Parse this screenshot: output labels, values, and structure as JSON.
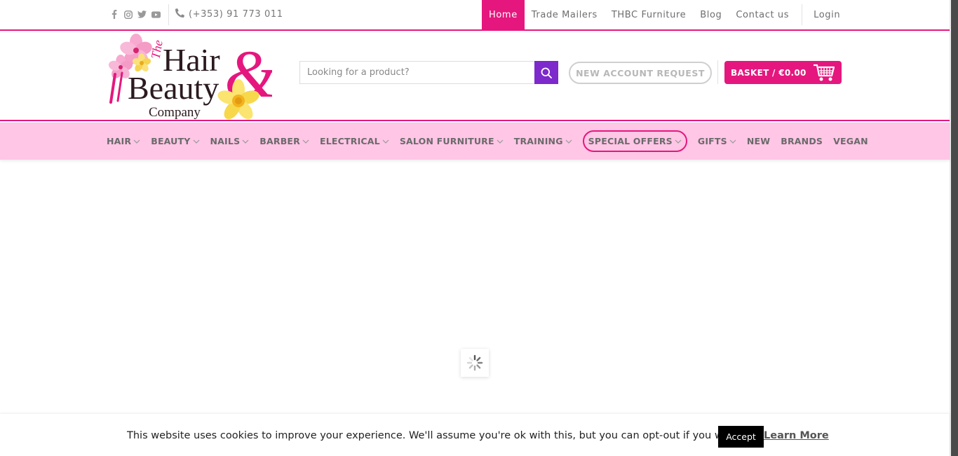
{
  "topbar": {
    "phone": "(+353) 91 773 011",
    "nav": [
      {
        "label": "Home",
        "active": true
      },
      {
        "label": "Trade Mailers",
        "active": false
      },
      {
        "label": "THBC Furniture",
        "active": false
      },
      {
        "label": "Blog",
        "active": false
      },
      {
        "label": "Contact us",
        "active": false
      }
    ],
    "login": "Login",
    "social_icons": [
      "facebook-icon",
      "instagram-icon",
      "twitter-icon",
      "youtube-icon"
    ]
  },
  "header": {
    "logo": {
      "line1": "The",
      "line2": "Hair",
      "line3": "Beauty",
      "line4": "Company",
      "ampersand": "&"
    },
    "search_placeholder": "Looking for a product?",
    "account_button": "NEW ACCOUNT REQUEST",
    "basket_label": "BASKET / €0.00"
  },
  "mainnav": {
    "items": [
      {
        "label": "HAIR",
        "dropdown": true
      },
      {
        "label": "BEAUTY",
        "dropdown": true
      },
      {
        "label": "NAILS",
        "dropdown": true
      },
      {
        "label": "BARBER",
        "dropdown": true
      },
      {
        "label": "ELECTRICAL",
        "dropdown": true
      },
      {
        "label": "SALON FURNITURE",
        "dropdown": true
      },
      {
        "label": "TRAINING",
        "dropdown": true
      },
      {
        "label": "SPECIAL OFFERS",
        "dropdown": true,
        "highlight": true
      },
      {
        "label": "GIFTS",
        "dropdown": true
      },
      {
        "label": "NEW",
        "dropdown": false
      },
      {
        "label": "BRANDS",
        "dropdown": false
      },
      {
        "label": "VEGAN",
        "dropdown": false
      }
    ]
  },
  "cookie": {
    "message": "This website uses cookies to improve your experience. We'll assume you're ok with this, but you can opt-out if you wish.",
    "accept": "Accept",
    "learn_more": "Learn More"
  },
  "colors": {
    "brand_pink": "#e5177e",
    "nav_bg": "#ffc6e6",
    "search_button": "#7d29cc"
  }
}
